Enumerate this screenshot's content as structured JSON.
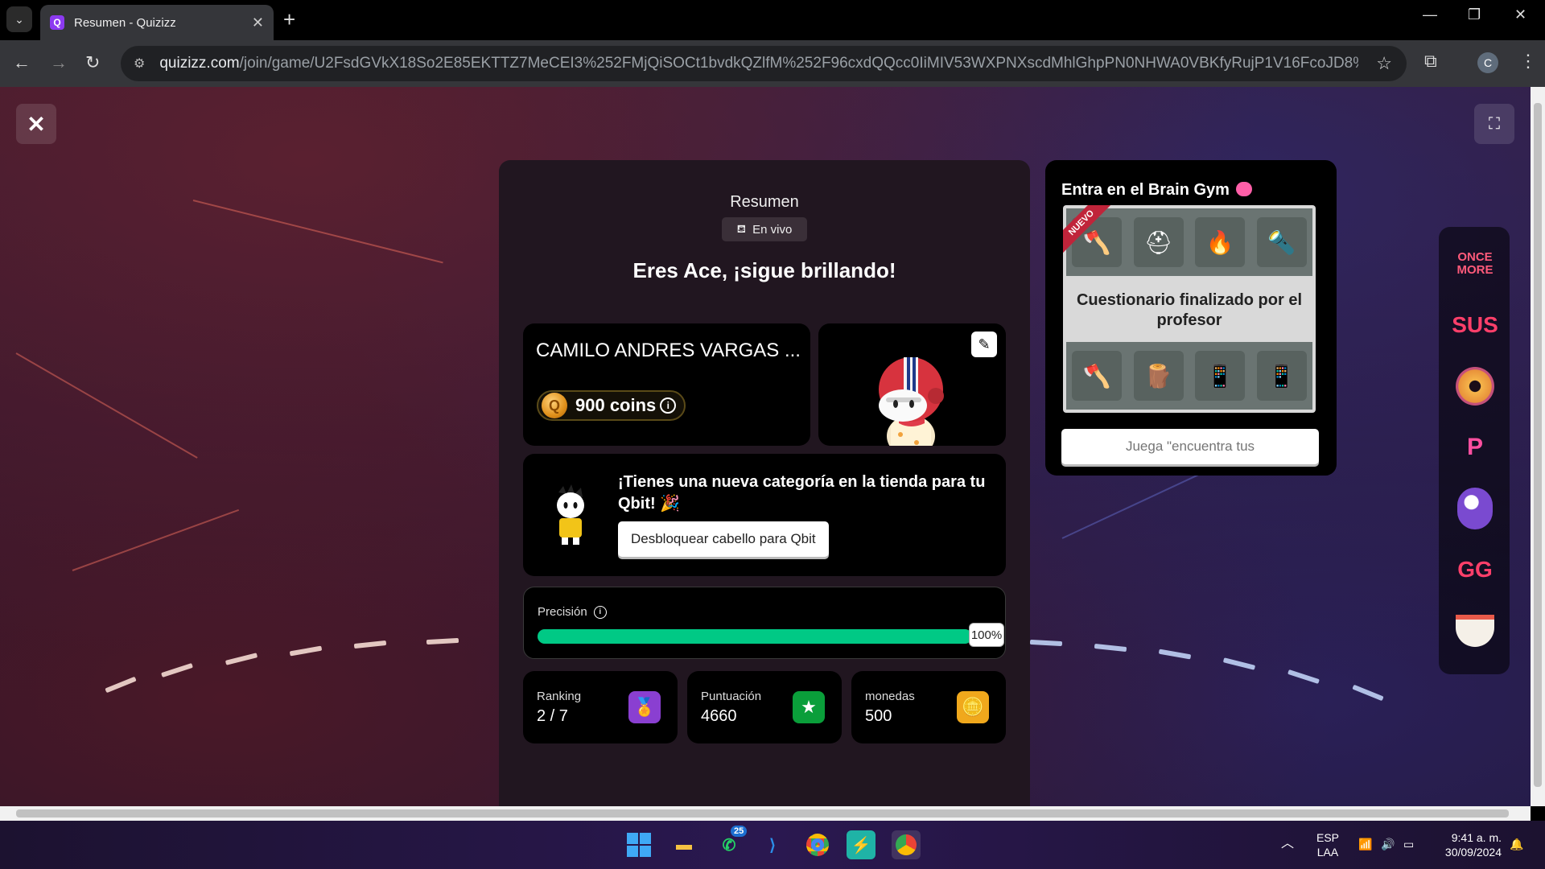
{
  "browser": {
    "tab_title": "Resumen - Quizizz",
    "url_host": "quizizz.com",
    "url_path": "/join/game/U2FsdGVkX18So2E85EKTTZ7MeCEI3%252FMjQiSOCt1bvdkQZlfM%252F96cxdQQcc0IiMIV53WXPNXscdMhlGhpPN0NHWA0VBKfyRujP1V16FcoJD8%253D?page=nps&p...",
    "profile_initial": "C"
  },
  "summary": {
    "title": "Resumen",
    "mode_label": "En vivo",
    "headline": "Eres Ace, ¡sigue brillando!",
    "player_name": "CAMILO ANDRES VARGAS ...",
    "coins_label": "900 coins",
    "promo_text": "¡Tienes una nueva categoría en la tienda para tu Qbit! 🎉",
    "promo_button": "Desbloquear cabello para Qbit",
    "accuracy_label": "Precisión",
    "accuracy_value": "100%",
    "accuracy_fraction": 1.0,
    "accent_color": "#00c985",
    "stats": [
      {
        "label": "Ranking",
        "value": "2 / 7",
        "icon": "medal-icon",
        "color": "#8a3fd1"
      },
      {
        "label": "Puntuación",
        "value": "4660",
        "icon": "star-icon",
        "color": "#0a9e3a"
      },
      {
        "label": "monedas",
        "value": "500",
        "icon": "coins-icon",
        "color": "#f0a81c"
      }
    ]
  },
  "brain_gym": {
    "title": "Entra en el Brain Gym",
    "badge": "NUEVO",
    "caption": "Cuestionario finalizado por el profesor",
    "input_placeholder": "Juega \"encuentra tus"
  },
  "rail": {
    "games": [
      "ONCE MORE",
      "SUS",
      "",
      "P",
      "",
      "GG",
      ""
    ]
  },
  "taskbar": {
    "whatsapp_badge": "25",
    "lang_line1": "ESP",
    "lang_line2": "LAA",
    "time": "9:41 a. m.",
    "date": "30/09/2024"
  }
}
